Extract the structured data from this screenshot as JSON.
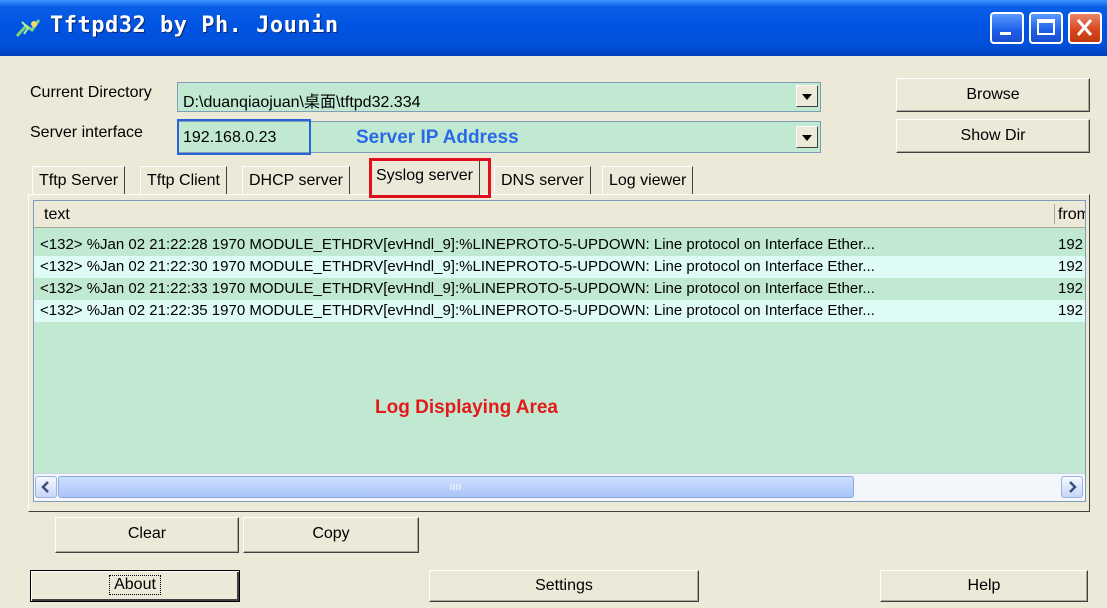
{
  "window": {
    "title": "Tftpd32 by Ph. Jounin",
    "controls": [
      "minimize-icon",
      "maximize-icon",
      "close-icon"
    ]
  },
  "current_directory": {
    "label": "Current Directory",
    "value": "D:\\duanqiaojuan\\桌面\\tftpd32.334",
    "browse_label": "Browse"
  },
  "server_interface": {
    "label": "Server interface",
    "value": "192.168.0.23",
    "show_dir_label": "Show Dir"
  },
  "annotations": {
    "server_ip": "Server IP Address",
    "log_area": "Log Displaying Area",
    "colors": {
      "blue": "#2864d8",
      "red": "#e10e1e"
    }
  },
  "tabs": [
    {
      "label": "Tftp Server",
      "active": false
    },
    {
      "label": "Tftp Client",
      "active": false
    },
    {
      "label": "DHCP server",
      "active": false
    },
    {
      "label": "Syslog server",
      "active": true
    },
    {
      "label": "DNS server",
      "active": false
    },
    {
      "label": "Log viewer",
      "active": false
    }
  ],
  "log": {
    "columns": [
      "text",
      "from"
    ],
    "rows": [
      {
        "text": "<132> %Jan 02 21:22:28 1970 MODULE_ETHDRV[evHndl_9]:%LINEPROTO-5-UPDOWN: Line protocol on Interface Ether...",
        "from": "192"
      },
      {
        "text": "<132> %Jan 02 21:22:30 1970 MODULE_ETHDRV[evHndl_9]:%LINEPROTO-5-UPDOWN: Line protocol on Interface Ether...",
        "from": "192"
      },
      {
        "text": "<132> %Jan 02 21:22:33 1970 MODULE_ETHDRV[evHndl_9]:%LINEPROTO-5-UPDOWN: Line protocol on Interface Ether...",
        "from": "192"
      },
      {
        "text": "<132> %Jan 02 21:22:35 1970 MODULE_ETHDRV[evHndl_9]:%LINEPROTO-5-UPDOWN: Line protocol on Interface Ether...",
        "from": "192"
      }
    ],
    "clear_label": "Clear",
    "copy_label": "Copy"
  },
  "footer": {
    "about_label": "About",
    "settings_label": "Settings",
    "help_label": "Help"
  },
  "colors": {
    "listview_bg": "#c1e9d2",
    "alt_row_bg": "#dffbf6",
    "titlebar": "#0054e3"
  }
}
